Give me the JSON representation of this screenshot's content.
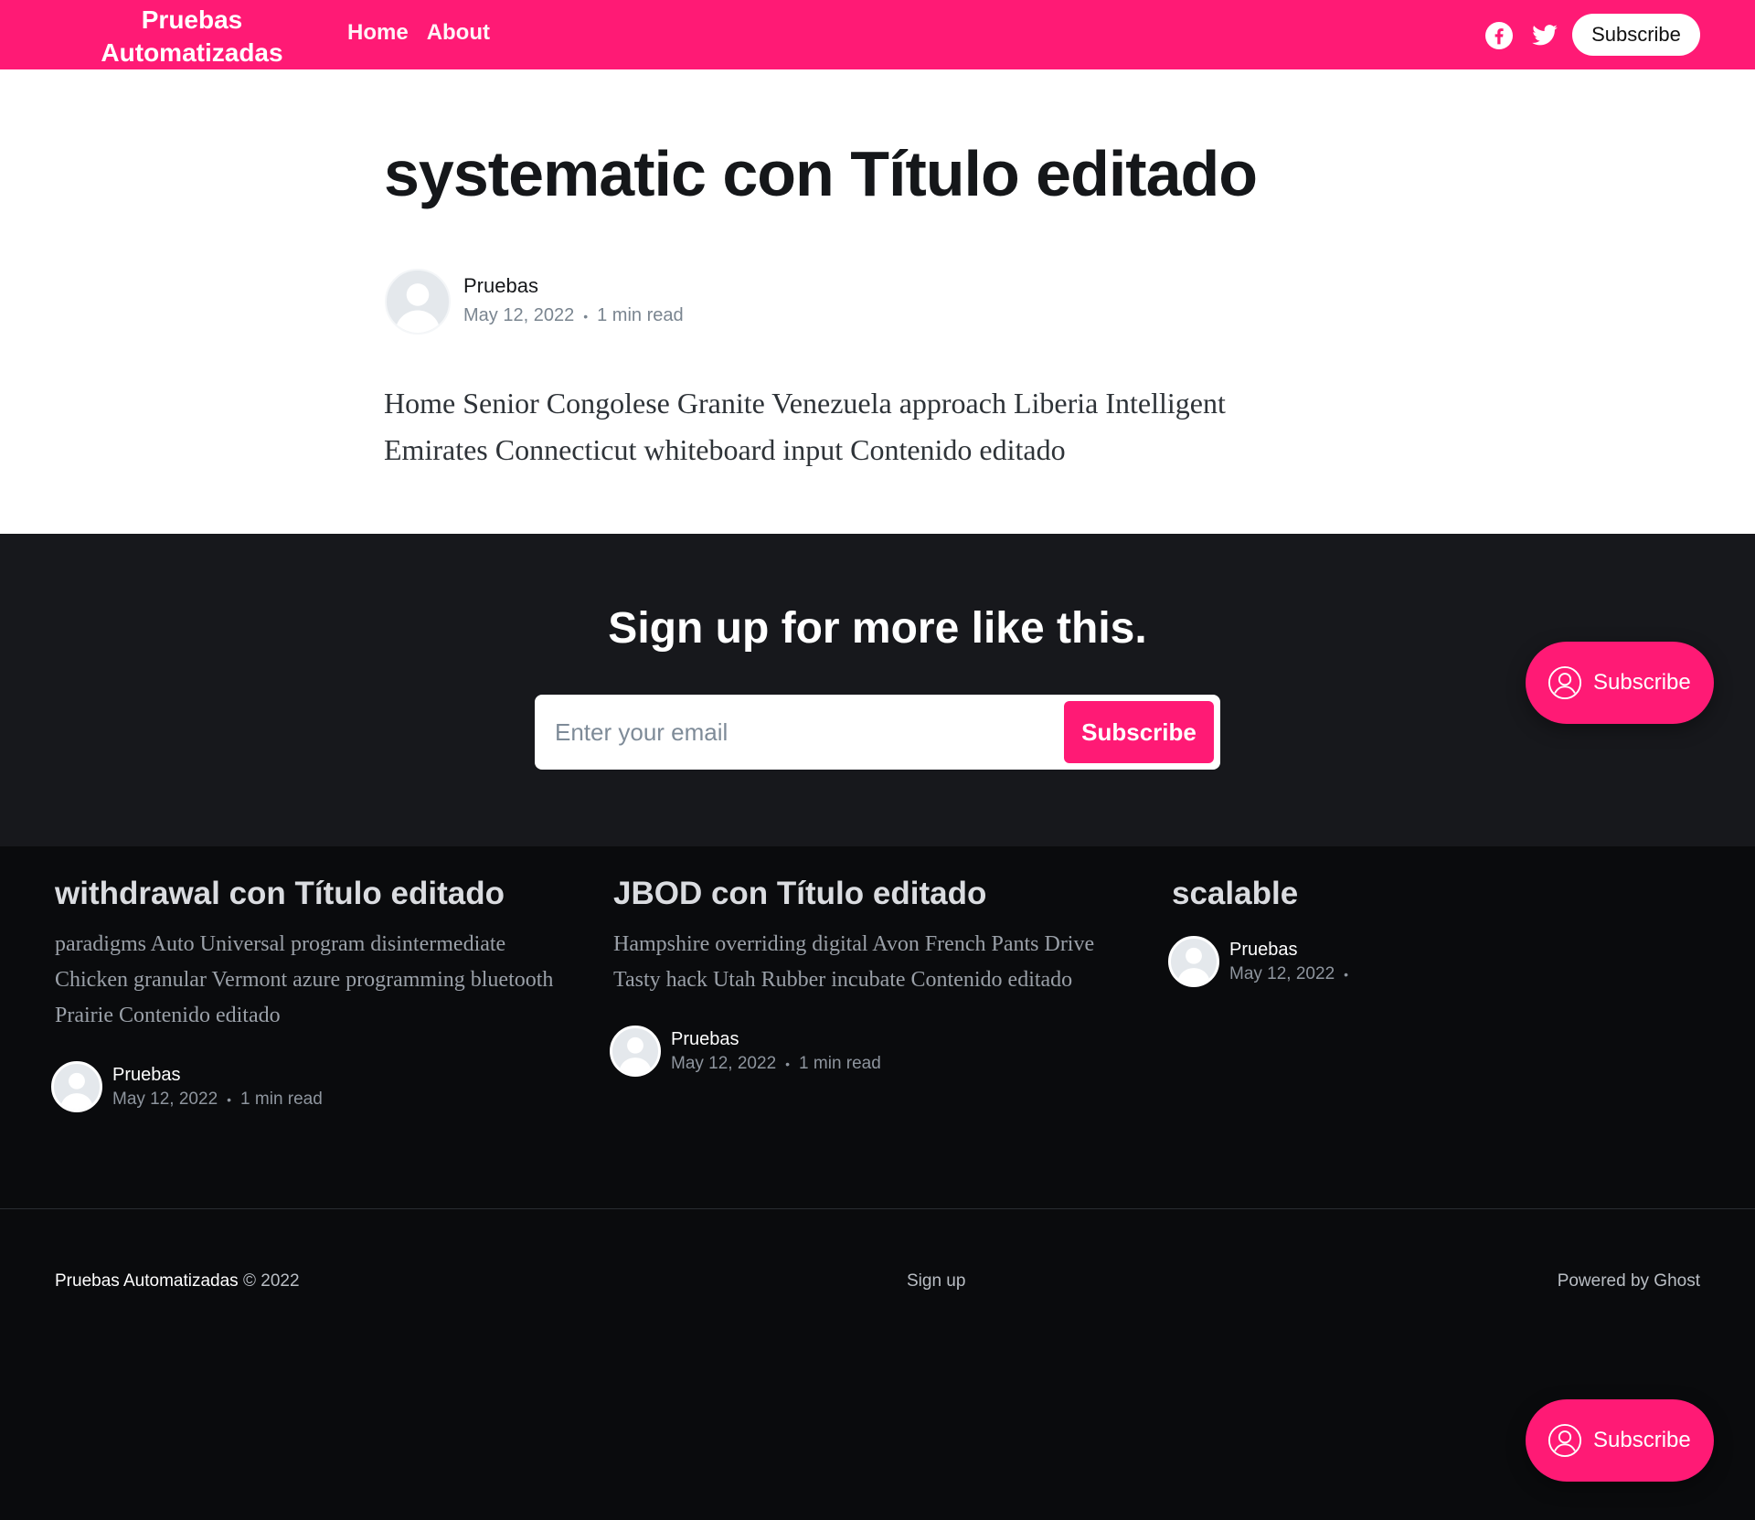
{
  "header": {
    "site_title": "Pruebas Automatizadas",
    "nav": [
      {
        "label": "Home"
      },
      {
        "label": "About"
      }
    ],
    "subscribe_label": "Subscribe",
    "brand_color": "#ff1a75",
    "icons": [
      "facebook-icon",
      "twitter-icon"
    ]
  },
  "article": {
    "title": "systematic con Título editado",
    "author": "Pruebas",
    "date": "May 12, 2022",
    "read_time": "1 min read",
    "body": "Home Senior Congolese Granite Venezuela approach Liberia Intelligent Emirates Connecticut whiteboard input Contenido editado"
  },
  "cta": {
    "title": "Sign up for more like this.",
    "email_placeholder": "Enter your email",
    "button_label": "Subscribe"
  },
  "floating": {
    "label": "Subscribe"
  },
  "related": [
    {
      "title": "withdrawal con Título editado",
      "excerpt": "paradigms Auto Universal program disintermediate Chicken granular Vermont azure programming bluetooth Prairie Contenido editado",
      "author": "Pruebas",
      "date": "May 12, 2022",
      "read_time": "1 min read"
    },
    {
      "title": "JBOD con Título editado",
      "excerpt": "Hampshire overriding digital Avon French Pants Drive Tasty hack Utah Rubber incubate Contenido editado",
      "author": "Pruebas",
      "date": "May 12, 2022",
      "read_time": "1 min read"
    },
    {
      "title": "scalable",
      "excerpt": "",
      "author": "Pruebas",
      "date": "May 12, 2022",
      "read_time": ""
    }
  ],
  "footer": {
    "site_name": "Pruebas Automatizadas",
    "copyright": "© 2022",
    "signup": "Sign up",
    "powered": "Powered by Ghost"
  }
}
